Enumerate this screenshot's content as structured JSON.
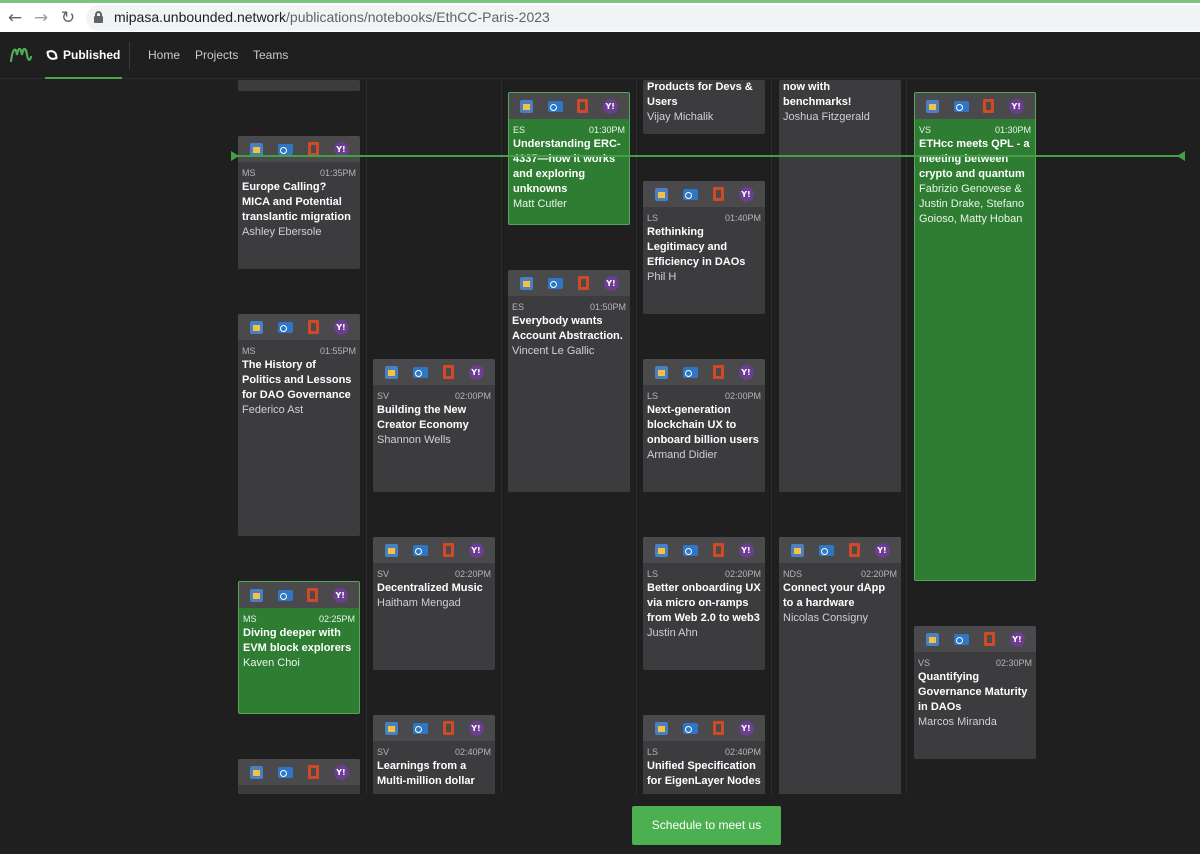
{
  "browser": {
    "url_host": "mipasa.unbounded.network",
    "url_path": "/publications/notebooks/EthCC-Paris-2023"
  },
  "nav": {
    "published": "Published",
    "links": [
      "Home",
      "Projects",
      "Teams"
    ]
  },
  "cta": "Schedule to meet us",
  "colors": {
    "accent": "#4caf50",
    "card": "#3c3c3f",
    "active_card": "#2e7d32"
  },
  "columns": [
    {
      "cards": [
        {
          "room": "MS",
          "time": "01:35PM",
          "title": "Europe Calling? MICA and Potential translantic migration",
          "speaker": "Ashley Ebersole"
        },
        {
          "room": "MS",
          "time": "01:55PM",
          "title": "The History of Politics and Lessons for DAO Governance",
          "speaker": "Federico Ast"
        },
        {
          "room": "MS",
          "time": "02:25PM",
          "title": "Diving deeper with EVM block explorers",
          "speaker": "Kaven Choi"
        }
      ]
    },
    {
      "cards": [
        {
          "room": "SV",
          "time": "02:00PM",
          "title": "Building the New Creator Economy",
          "speaker": "Shannon Wells"
        },
        {
          "room": "SV",
          "time": "02:20PM",
          "title": "Decentralized Music",
          "speaker": "Haitham Mengad"
        },
        {
          "room": "SV",
          "time": "02:40PM",
          "title": "Learnings from a Multi-million dollar",
          "speaker": ""
        }
      ]
    },
    {
      "cards": [
        {
          "room": "ES",
          "time": "01:30PM",
          "title": "Understanding ERC-4337—how it works and exploring unknowns",
          "speaker": "Matt Cutler"
        },
        {
          "room": "ES",
          "time": "01:50PM",
          "title": "Everybody wants Account Abstraction.",
          "speaker": "Vincent Le Gallic"
        }
      ]
    },
    {
      "cards": [
        {
          "room": "",
          "time": "",
          "title": "Products for Devs & Users",
          "speaker": "Vijay Michalik"
        },
        {
          "room": "LS",
          "time": "01:40PM",
          "title": "Rethinking Legitimacy and Efficiency in DAOs",
          "speaker": "Phil H"
        },
        {
          "room": "LS",
          "time": "02:00PM",
          "title": "Next-generation blockchain UX to onboard billion users",
          "speaker": "Armand Didier"
        },
        {
          "room": "LS",
          "time": "02:20PM",
          "title": "Better onboarding UX via micro on-ramps from Web 2.0 to web3",
          "speaker": "Justin Ahn"
        },
        {
          "room": "LS",
          "time": "02:40PM",
          "title": "Unified Specification for EigenLayer Nodes",
          "speaker": ""
        }
      ]
    },
    {
      "cards": [
        {
          "room": "",
          "time": "",
          "title": "now with benchmarks!",
          "speaker": "Joshua Fitzgerald"
        },
        {
          "room": "NDS",
          "time": "02:20PM",
          "title": "Connect your dApp to a hardware",
          "speaker": "Nicolas Consigny"
        }
      ]
    },
    {
      "cards": [
        {
          "room": "VS",
          "time": "01:30PM",
          "title": "ETHcc meets QPL - a meeting between crypto and quantum",
          "speaker": "Fabrizio Genovese & Justin Drake, Stefano Goioso, Matty Hoban"
        },
        {
          "room": "VS",
          "time": "02:30PM",
          "title": "Quantifying Governance Maturity in DAOs",
          "speaker": "Marcos Miranda"
        }
      ]
    }
  ]
}
